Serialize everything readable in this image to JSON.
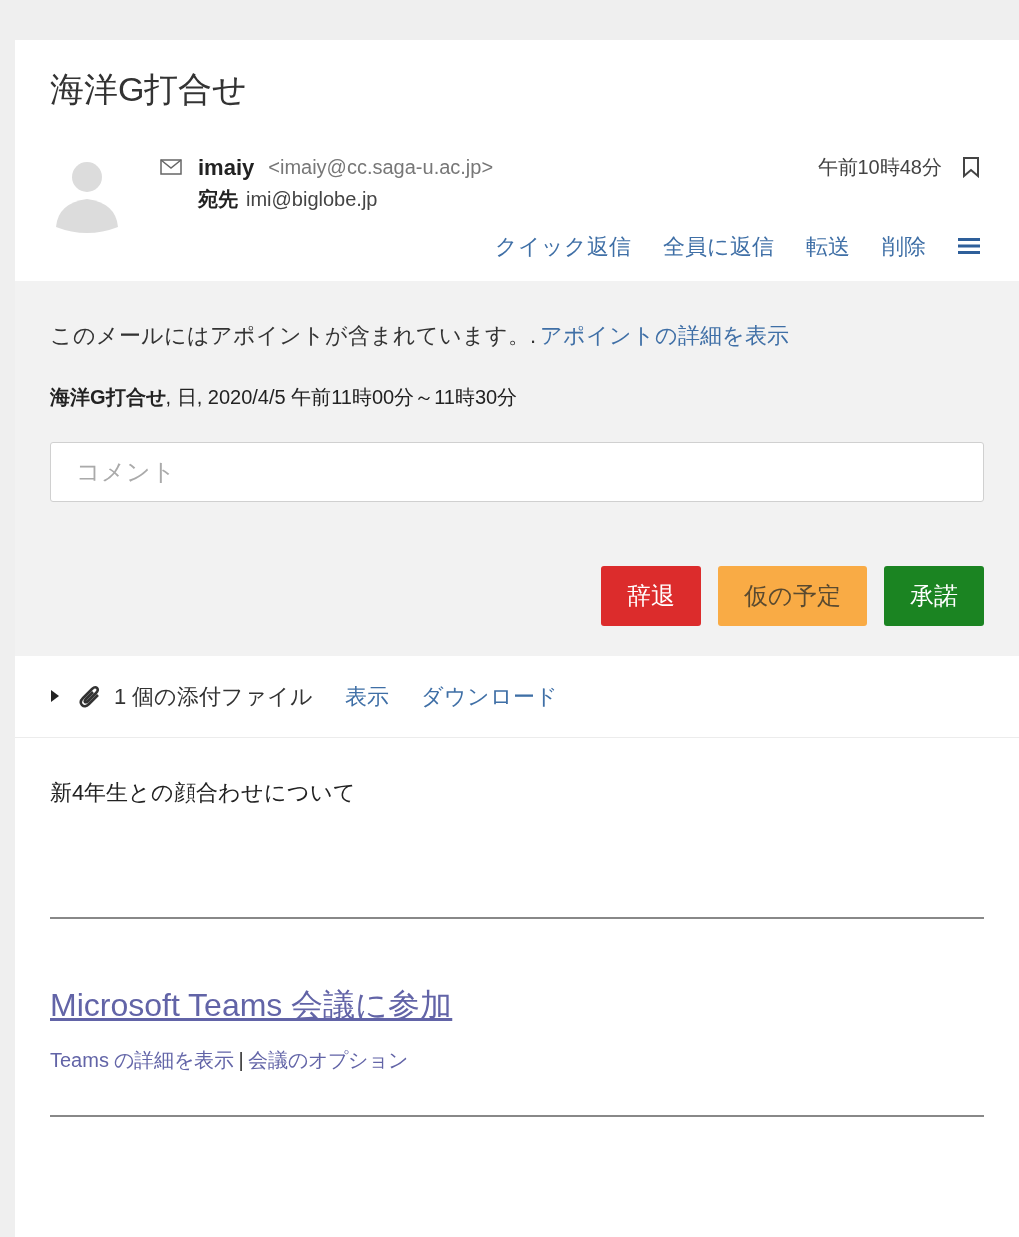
{
  "subject": "海洋G打合せ",
  "header": {
    "sender_name": "imaiy",
    "sender_email": "<imaiy@cc.saga-u.ac.jp>",
    "to_label": "宛先",
    "to": "imi@biglobe.jp",
    "time": "午前10時48分",
    "actions": [
      "クイック返信",
      "全員に返信",
      "転送",
      "削除"
    ]
  },
  "invite": {
    "notice": "このメールにはアポイントが含まれています。.",
    "details_link": "アポイントの詳細を表示",
    "summary": "**海洋G打合せ**, 日, 2020/4/5 午前11時00分～11時30分",
    "comment": {
      "placeholder": "コメント"
    },
    "buttons": [
      {
        "kind": "decline",
        "label": "辞退"
      },
      {
        "kind": "tentative",
        "label": "仮の予定"
      },
      {
        "kind": "accept",
        "label": "承諾"
      }
    ]
  },
  "attachments": {
    "expanded": false,
    "count_text": "1 個の添付ファイル",
    "actions": [
      "表示",
      "ダウンロード"
    ]
  },
  "body": {
    "text": "新4年生との顔合わせについて",
    "join_link": "Microsoft Teams 会議に参加",
    "details_link": "Teams の詳細を表示",
    "separator": "|",
    "options_link": "会議のオプション"
  }
}
